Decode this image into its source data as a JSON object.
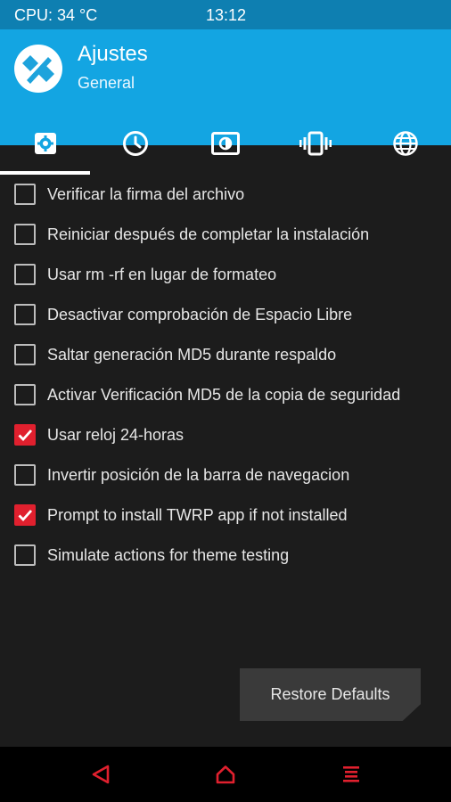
{
  "status": {
    "cpu": "CPU: 34 °C",
    "time": "13:12"
  },
  "header": {
    "title": "Ajustes",
    "subtitle": "General",
    "logo_icon": "twrp-logo-icon"
  },
  "tabs": [
    {
      "icon": "gear-icon",
      "active": true
    },
    {
      "icon": "clock-icon",
      "active": false
    },
    {
      "icon": "brightness-icon",
      "active": false
    },
    {
      "icon": "vibrate-icon",
      "active": false
    },
    {
      "icon": "globe-icon",
      "active": false
    }
  ],
  "settings": [
    {
      "label": "Verificar la firma del archivo",
      "checked": false
    },
    {
      "label": "Reiniciar después de completar la instalación",
      "checked": false
    },
    {
      "label": "Usar rm -rf en lugar de formateo",
      "checked": false
    },
    {
      "label": "Desactivar comprobación de Espacio Libre",
      "checked": false
    },
    {
      "label": "Saltar generación MD5 durante respaldo",
      "checked": false
    },
    {
      "label": "Activar Verificación MD5 de la copia de seguridad",
      "checked": false
    },
    {
      "label": "Usar reloj 24-horas",
      "checked": true
    },
    {
      "label": "Invertir posición de la barra de navegacion",
      "checked": false
    },
    {
      "label": "Prompt to install TWRP app if not installed",
      "checked": true
    },
    {
      "label": "Simulate actions for theme testing",
      "checked": false
    }
  ],
  "restore_button": {
    "label": "Restore Defaults"
  },
  "navbar": {
    "back_icon": "back-triangle-icon",
    "home_icon": "home-icon",
    "menu_icon": "menu-icon"
  },
  "colors": {
    "status_bar": "#0e7fb1",
    "header": "#13a5e2",
    "accent_red": "#e0202e",
    "background": "#1c1c1c"
  }
}
